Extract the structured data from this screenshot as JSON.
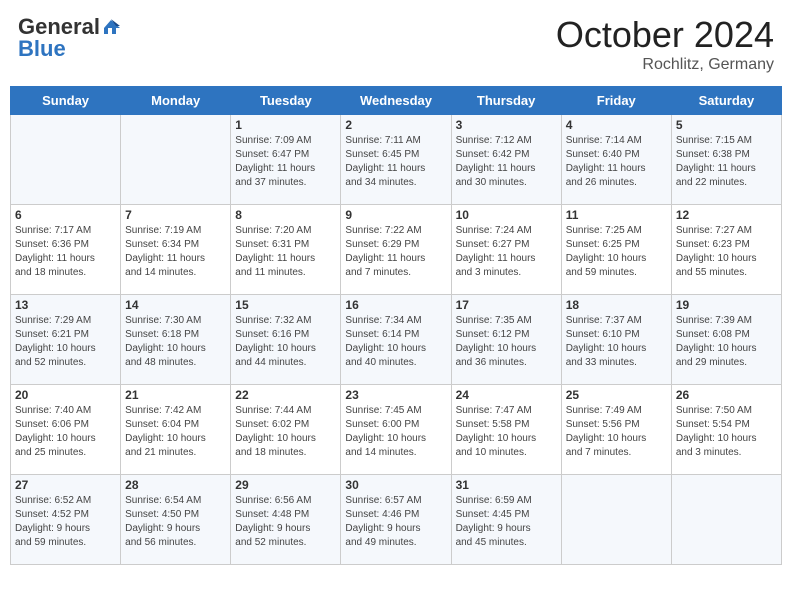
{
  "header": {
    "logo_general": "General",
    "logo_blue": "Blue",
    "month": "October 2024",
    "location": "Rochlitz, Germany"
  },
  "days_of_week": [
    "Sunday",
    "Monday",
    "Tuesday",
    "Wednesday",
    "Thursday",
    "Friday",
    "Saturday"
  ],
  "weeks": [
    [
      {
        "day": "",
        "info": ""
      },
      {
        "day": "",
        "info": ""
      },
      {
        "day": "1",
        "info": "Sunrise: 7:09 AM\nSunset: 6:47 PM\nDaylight: 11 hours\nand 37 minutes."
      },
      {
        "day": "2",
        "info": "Sunrise: 7:11 AM\nSunset: 6:45 PM\nDaylight: 11 hours\nand 34 minutes."
      },
      {
        "day": "3",
        "info": "Sunrise: 7:12 AM\nSunset: 6:42 PM\nDaylight: 11 hours\nand 30 minutes."
      },
      {
        "day": "4",
        "info": "Sunrise: 7:14 AM\nSunset: 6:40 PM\nDaylight: 11 hours\nand 26 minutes."
      },
      {
        "day": "5",
        "info": "Sunrise: 7:15 AM\nSunset: 6:38 PM\nDaylight: 11 hours\nand 22 minutes."
      }
    ],
    [
      {
        "day": "6",
        "info": "Sunrise: 7:17 AM\nSunset: 6:36 PM\nDaylight: 11 hours\nand 18 minutes."
      },
      {
        "day": "7",
        "info": "Sunrise: 7:19 AM\nSunset: 6:34 PM\nDaylight: 11 hours\nand 14 minutes."
      },
      {
        "day": "8",
        "info": "Sunrise: 7:20 AM\nSunset: 6:31 PM\nDaylight: 11 hours\nand 11 minutes."
      },
      {
        "day": "9",
        "info": "Sunrise: 7:22 AM\nSunset: 6:29 PM\nDaylight: 11 hours\nand 7 minutes."
      },
      {
        "day": "10",
        "info": "Sunrise: 7:24 AM\nSunset: 6:27 PM\nDaylight: 11 hours\nand 3 minutes."
      },
      {
        "day": "11",
        "info": "Sunrise: 7:25 AM\nSunset: 6:25 PM\nDaylight: 10 hours\nand 59 minutes."
      },
      {
        "day": "12",
        "info": "Sunrise: 7:27 AM\nSunset: 6:23 PM\nDaylight: 10 hours\nand 55 minutes."
      }
    ],
    [
      {
        "day": "13",
        "info": "Sunrise: 7:29 AM\nSunset: 6:21 PM\nDaylight: 10 hours\nand 52 minutes."
      },
      {
        "day": "14",
        "info": "Sunrise: 7:30 AM\nSunset: 6:18 PM\nDaylight: 10 hours\nand 48 minutes."
      },
      {
        "day": "15",
        "info": "Sunrise: 7:32 AM\nSunset: 6:16 PM\nDaylight: 10 hours\nand 44 minutes."
      },
      {
        "day": "16",
        "info": "Sunrise: 7:34 AM\nSunset: 6:14 PM\nDaylight: 10 hours\nand 40 minutes."
      },
      {
        "day": "17",
        "info": "Sunrise: 7:35 AM\nSunset: 6:12 PM\nDaylight: 10 hours\nand 36 minutes."
      },
      {
        "day": "18",
        "info": "Sunrise: 7:37 AM\nSunset: 6:10 PM\nDaylight: 10 hours\nand 33 minutes."
      },
      {
        "day": "19",
        "info": "Sunrise: 7:39 AM\nSunset: 6:08 PM\nDaylight: 10 hours\nand 29 minutes."
      }
    ],
    [
      {
        "day": "20",
        "info": "Sunrise: 7:40 AM\nSunset: 6:06 PM\nDaylight: 10 hours\nand 25 minutes."
      },
      {
        "day": "21",
        "info": "Sunrise: 7:42 AM\nSunset: 6:04 PM\nDaylight: 10 hours\nand 21 minutes."
      },
      {
        "day": "22",
        "info": "Sunrise: 7:44 AM\nSunset: 6:02 PM\nDaylight: 10 hours\nand 18 minutes."
      },
      {
        "day": "23",
        "info": "Sunrise: 7:45 AM\nSunset: 6:00 PM\nDaylight: 10 hours\nand 14 minutes."
      },
      {
        "day": "24",
        "info": "Sunrise: 7:47 AM\nSunset: 5:58 PM\nDaylight: 10 hours\nand 10 minutes."
      },
      {
        "day": "25",
        "info": "Sunrise: 7:49 AM\nSunset: 5:56 PM\nDaylight: 10 hours\nand 7 minutes."
      },
      {
        "day": "26",
        "info": "Sunrise: 7:50 AM\nSunset: 5:54 PM\nDaylight: 10 hours\nand 3 minutes."
      }
    ],
    [
      {
        "day": "27",
        "info": "Sunrise: 6:52 AM\nSunset: 4:52 PM\nDaylight: 9 hours\nand 59 minutes."
      },
      {
        "day": "28",
        "info": "Sunrise: 6:54 AM\nSunset: 4:50 PM\nDaylight: 9 hours\nand 56 minutes."
      },
      {
        "day": "29",
        "info": "Sunrise: 6:56 AM\nSunset: 4:48 PM\nDaylight: 9 hours\nand 52 minutes."
      },
      {
        "day": "30",
        "info": "Sunrise: 6:57 AM\nSunset: 4:46 PM\nDaylight: 9 hours\nand 49 minutes."
      },
      {
        "day": "31",
        "info": "Sunrise: 6:59 AM\nSunset: 4:45 PM\nDaylight: 9 hours\nand 45 minutes."
      },
      {
        "day": "",
        "info": ""
      },
      {
        "day": "",
        "info": ""
      }
    ]
  ]
}
